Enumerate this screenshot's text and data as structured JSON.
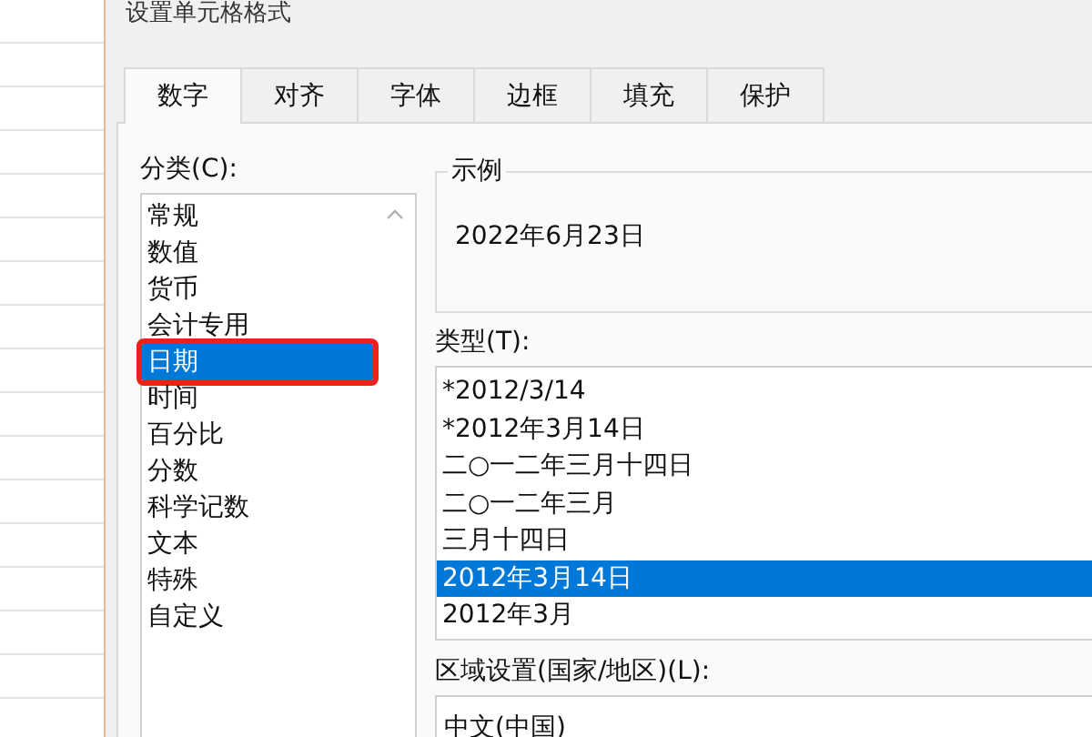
{
  "window": {
    "title": "设置单元格格式"
  },
  "tabs": [
    {
      "label": "数字",
      "selected": true
    },
    {
      "label": "对齐",
      "selected": false
    },
    {
      "label": "字体",
      "selected": false
    },
    {
      "label": "边框",
      "selected": false
    },
    {
      "label": "填充",
      "selected": false
    },
    {
      "label": "保护",
      "selected": false
    }
  ],
  "category": {
    "label": "分类(C):",
    "items": [
      {
        "label": "常规",
        "selected": false
      },
      {
        "label": "数值",
        "selected": false
      },
      {
        "label": "货币",
        "selected": false
      },
      {
        "label": "会计专用",
        "selected": false
      },
      {
        "label": "日期",
        "selected": true
      },
      {
        "label": "时间",
        "selected": false
      },
      {
        "label": "百分比",
        "selected": false
      },
      {
        "label": "分数",
        "selected": false
      },
      {
        "label": "科学记数",
        "selected": false
      },
      {
        "label": "文本",
        "selected": false
      },
      {
        "label": "特殊",
        "selected": false
      },
      {
        "label": "自定义",
        "selected": false
      }
    ]
  },
  "sample": {
    "title": "示例",
    "value": "2022年6月23日"
  },
  "type": {
    "label": "类型(T):",
    "items": [
      {
        "label": "*2012/3/14",
        "selected": false
      },
      {
        "label": "*2012年3月14日",
        "selected": false
      },
      {
        "label": "二○一二年三月十四日",
        "selected": false
      },
      {
        "label": "二○一二年三月",
        "selected": false
      },
      {
        "label": "三月十四日",
        "selected": false
      },
      {
        "label": "2012年3月14日",
        "selected": true
      },
      {
        "label": "2012年3月",
        "selected": false
      }
    ]
  },
  "locale": {
    "label": "区域设置(国家/地区)(L):",
    "value": "中文(中国)"
  }
}
